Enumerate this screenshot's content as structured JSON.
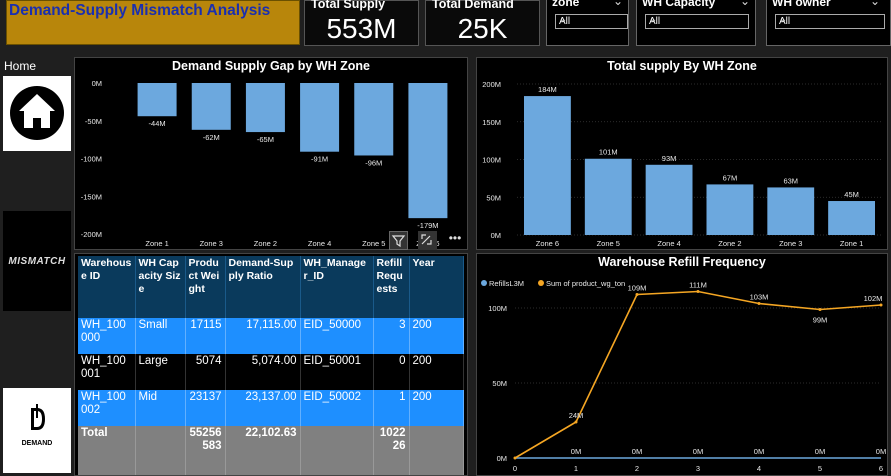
{
  "header": {
    "title": "Demand-Supply Mismatch Analysis",
    "total_supply_label": "Total Supply",
    "total_supply_value": "553M",
    "total_demand_label": "Total Demand",
    "total_demand_value": "25K"
  },
  "slicers": [
    {
      "title": "zone",
      "value": "All"
    },
    {
      "title": "WH Capacity",
      "value": "All"
    },
    {
      "title": "WH owner",
      "value": "All"
    }
  ],
  "nav": {
    "home_label": "Home",
    "mismatch_text": "MISMATCH",
    "demand_text": "DEMAND"
  },
  "colors": {
    "title_bg": "#b8860b",
    "title_text": "#1a2fb0",
    "bar": "#6ca8de",
    "line_orange": "#f5a623",
    "table_header": "#0a3a5c",
    "row_selected": "#1e8fff",
    "total_row": "#808080"
  },
  "chart_data": [
    {
      "type": "bar",
      "title": "Demand Supply Gap by WH Zone",
      "categories": [
        "Zone 1",
        "Zone 3",
        "Zone 2",
        "Zone 4",
        "Zone 5",
        "Zone 6"
      ],
      "values": [
        -44,
        -62,
        -65,
        -91,
        -96,
        -179
      ],
      "value_labels": [
        "-44M",
        "-62M",
        "-65M",
        "-91M",
        "-96M",
        "-179M"
      ],
      "yticks": [
        "0M",
        "-50M",
        "-100M",
        "-150M",
        "-200M"
      ],
      "ytick_values": [
        0,
        -50,
        -100,
        -150,
        -200
      ],
      "ylim": [
        -200,
        0
      ]
    },
    {
      "type": "bar",
      "title": "Total supply By WH Zone",
      "categories": [
        "Zone 6",
        "Zone 5",
        "Zone 4",
        "Zone 2",
        "Zone 3",
        "Zone 1"
      ],
      "values": [
        184,
        101,
        93,
        67,
        63,
        45
      ],
      "value_labels": [
        "184M",
        "101M",
        "93M",
        "67M",
        "63M",
        "45M"
      ],
      "yticks": [
        "200M",
        "150M",
        "100M",
        "50M",
        "0M"
      ],
      "ytick_values": [
        200,
        150,
        100,
        50,
        0
      ],
      "ylim": [
        0,
        200
      ]
    },
    {
      "type": "line",
      "title": "Warehouse Refill Frequency",
      "legend": [
        "RefillsL3M",
        "Sum of product_wg_ton"
      ],
      "x": [
        0,
        1,
        2,
        3,
        4,
        5,
        6
      ],
      "series": [
        {
          "name": "RefillsL3M",
          "values": [
            0,
            0,
            0,
            0,
            0,
            0,
            0
          ],
          "labels": [
            "0M",
            "0M",
            "0M",
            "0M",
            "0M",
            "0M",
            "0M"
          ]
        },
        {
          "name": "Sum of product_wg_ton",
          "values": [
            0,
            24,
            109,
            111,
            103,
            99,
            102
          ],
          "labels": [
            "",
            "24M",
            "109M",
            "111M",
            "103M",
            "99M",
            "102M"
          ]
        }
      ],
      "yticks": [
        "100M",
        "50M",
        "0M"
      ],
      "ytick_values": [
        100,
        50,
        0
      ],
      "ylim": [
        0,
        120
      ]
    }
  ],
  "table": {
    "columns": [
      "Warehouse ID",
      "WH Capacity Size",
      "Product Weight",
      "Demand-Supply Ratio",
      "WH_Manager_ID",
      "Refill Requests",
      "Year"
    ],
    "rows": [
      {
        "cells": [
          "WH_100000",
          "Small",
          "17115",
          "17,115.00",
          "EID_50000",
          "3",
          "200"
        ],
        "selected": true
      },
      {
        "cells": [
          "WH_100001",
          "Large",
          "5074",
          "5,074.00",
          "EID_50001",
          "0",
          "200"
        ],
        "selected": false
      },
      {
        "cells": [
          "WH_100002",
          "Mid",
          "23137",
          "23,137.00",
          "EID_50002",
          "1",
          "200"
        ],
        "selected": true
      }
    ],
    "total": [
      "Total",
      "",
      "55256583",
      "22,102.63",
      "",
      "102226",
      ""
    ]
  }
}
